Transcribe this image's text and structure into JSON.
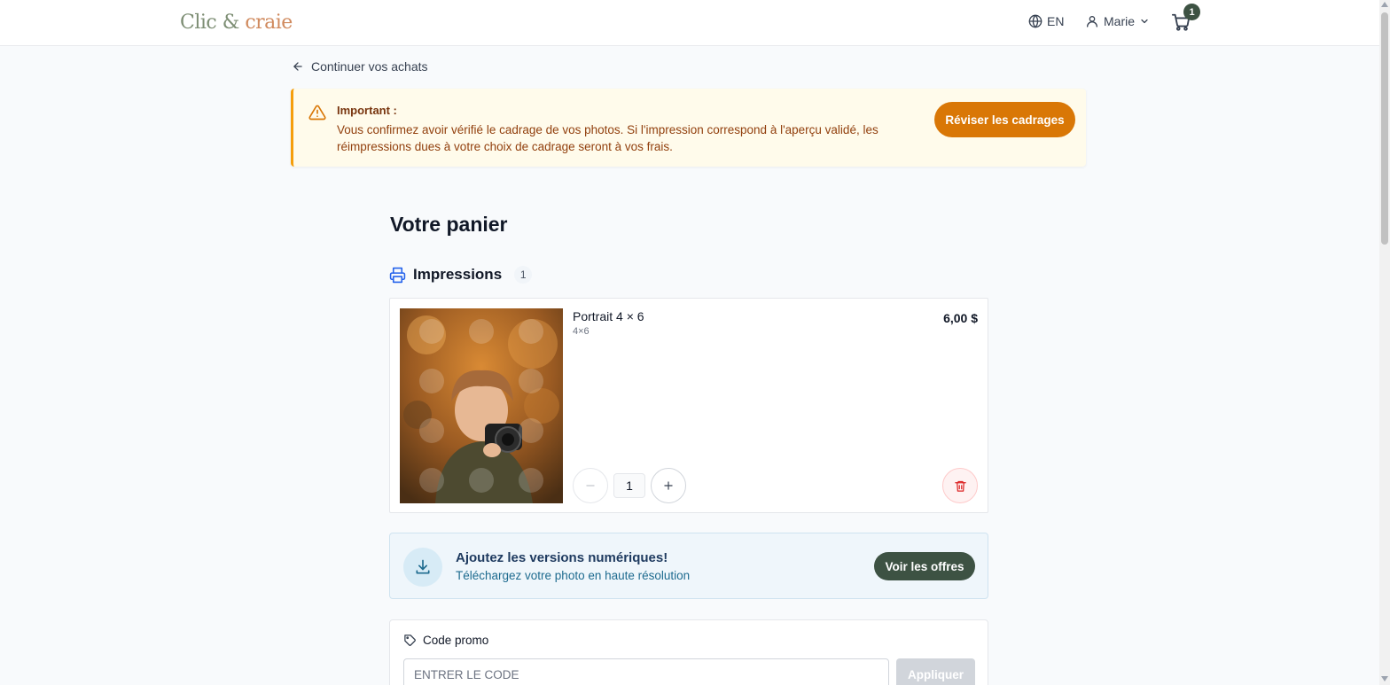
{
  "header": {
    "logo_part1": "Clic &",
    "logo_part2": "craie",
    "language": "EN",
    "user_name": "Marie",
    "cart_count": "1",
    "icons": [
      "globe-icon",
      "user-icon",
      "chevron-down-icon",
      "cart-icon"
    ]
  },
  "nav": {
    "back_label": "Continuer vos achats"
  },
  "alert": {
    "title": "Important :",
    "text": "Vous confirmez avoir vérifié le cadrage de vos photos. Si l'impression correspond à l'aperçu validé, les réimpressions dues à votre choix de cadrage seront à vos frais.",
    "button_label": "Réviser les cadrages"
  },
  "page": {
    "title": "Votre panier"
  },
  "section": {
    "label": "Impressions",
    "count": "1"
  },
  "item": {
    "name": "Portrait 4 × 6",
    "size": "4×6",
    "price": "6,00 $",
    "quantity": "1"
  },
  "digital": {
    "title": "Ajoutez les versions numériques!",
    "subtitle": "Téléchargez votre photo en haute résolution",
    "button_label": "Voir les offres"
  },
  "promo": {
    "label": "Code promo",
    "placeholder": "ENTRER LE CODE",
    "button_label": "Appliquer"
  },
  "colors": {
    "accent_orange": "#d97706",
    "accent_green": "#3d5243",
    "alert_bg": "#fffbeb",
    "digital_bg": "#eff6fb"
  }
}
